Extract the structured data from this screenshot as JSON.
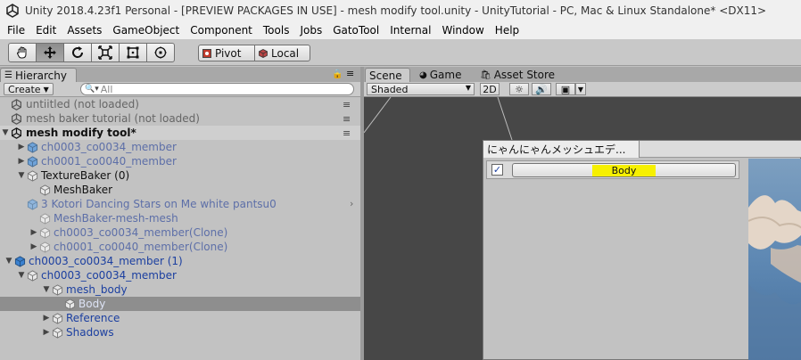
{
  "window": {
    "title": "Unity 2018.4.23f1 Personal - [PREVIEW PACKAGES IN USE] - mesh modify tool.unity - UnityTutorial - PC, Mac & Linux Standalone* <DX11>"
  },
  "menubar": {
    "items": [
      "File",
      "Edit",
      "Assets",
      "GameObject",
      "Component",
      "Tools",
      "Jobs",
      "GatoTool",
      "Internal",
      "Window",
      "Help"
    ]
  },
  "toolbar": {
    "pivot_label": "Pivot",
    "local_label": "Local"
  },
  "hierarchy": {
    "tab_label": "Hierarchy",
    "create_label": "Create",
    "search_placeholder": "All",
    "rows": [
      {
        "label": "untiitled (not loaded)"
      },
      {
        "label": "mesh baker tutorial (not loaded)"
      },
      {
        "label": "mesh modify tool*"
      },
      {
        "label": "ch0003_co0034_member"
      },
      {
        "label": "ch0001_co0040_member"
      },
      {
        "label": "TextureBaker (0)"
      },
      {
        "label": "MeshBaker"
      },
      {
        "label": "3 Kotori Dancing Stars on Me white pantsu0"
      },
      {
        "label": "MeshBaker-mesh-mesh"
      },
      {
        "label": "ch0003_co0034_member(Clone)"
      },
      {
        "label": "ch0001_co0040_member(Clone)"
      },
      {
        "label": "ch0003_co0034_member (1)"
      },
      {
        "label": "ch0003_co0034_member"
      },
      {
        "label": "mesh_body"
      },
      {
        "label": "Body"
      },
      {
        "label": "Reference"
      },
      {
        "label": "Shadows"
      }
    ]
  },
  "scene": {
    "tabs": [
      "Scene",
      "Game",
      "Asset Store"
    ],
    "shading_mode": "Shaded",
    "mode_2d": "2D"
  },
  "floating_window": {
    "title": "にゃんにゃんメッシュエデ...",
    "button_label": "Body",
    "checked": true
  },
  "colors": {
    "highlight": "#f6f000",
    "selection": "#8e8e8e",
    "prefab_text": "#1b3fa0"
  }
}
